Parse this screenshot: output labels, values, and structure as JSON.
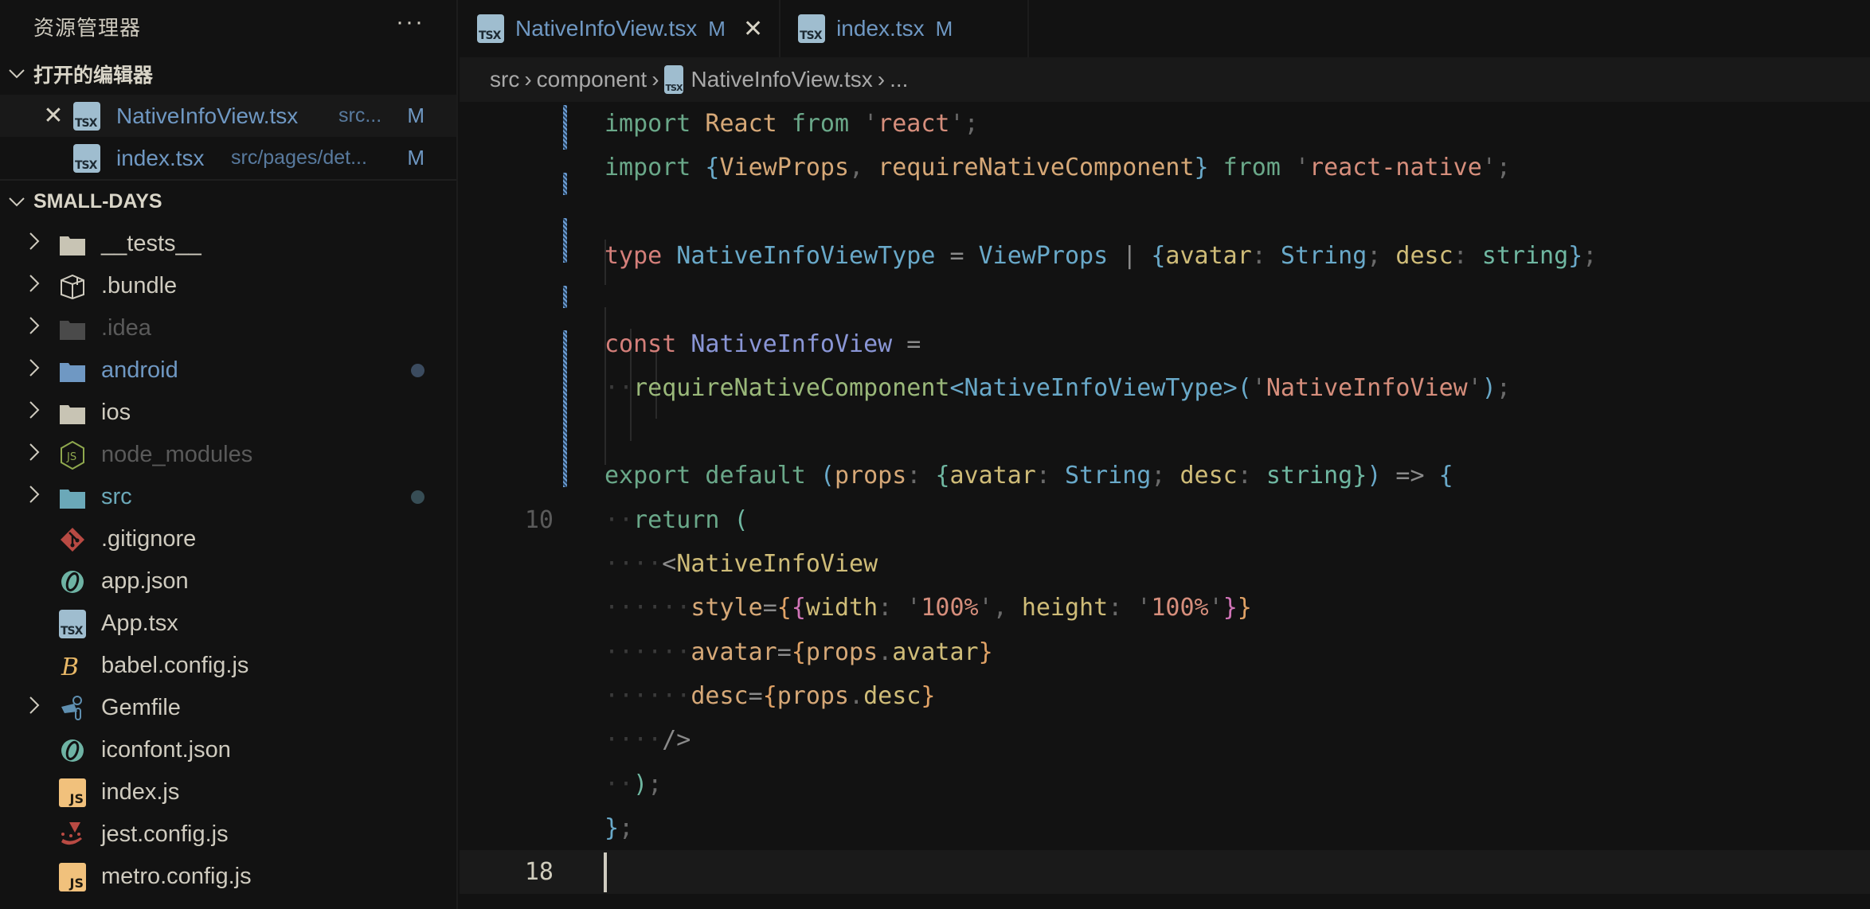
{
  "sidebar": {
    "title": "资源管理器",
    "more_label": "···",
    "open_editors": {
      "label": "打开的编辑器",
      "items": [
        {
          "name": "NativeInfoView.tsx",
          "path": "src...",
          "status": "M",
          "icon": "tsx-file-icon",
          "active": true
        },
        {
          "name": "index.tsx",
          "path": "src/pages/det...",
          "status": "M",
          "icon": "tsx-file-icon",
          "active": false
        }
      ]
    },
    "project": {
      "label": "SMALL-DAYS",
      "items": [
        {
          "name": "__tests__",
          "type": "folder",
          "icon": "folder-icon",
          "collapsed": true
        },
        {
          "name": ".bundle",
          "type": "folder",
          "icon": "package-box-icon",
          "collapsed": true
        },
        {
          "name": ".idea",
          "type": "folder",
          "icon": "folder-icon",
          "collapsed": true,
          "dimmed": true
        },
        {
          "name": "android",
          "type": "folder",
          "icon": "folder-icon",
          "collapsed": true,
          "modified": true
        },
        {
          "name": "ios",
          "type": "folder",
          "icon": "folder-icon",
          "collapsed": true
        },
        {
          "name": "node_modules",
          "type": "folder",
          "icon": "nodejs-icon",
          "collapsed": true,
          "dimmed": true
        },
        {
          "name": "src",
          "type": "folder",
          "icon": "folder-icon",
          "collapsed": true,
          "modified": true
        },
        {
          "name": ".gitignore",
          "type": "file",
          "icon": "git-icon"
        },
        {
          "name": "app.json",
          "type": "file",
          "icon": "json-swirl-icon"
        },
        {
          "name": "App.tsx",
          "type": "file",
          "icon": "tsx-file-icon"
        },
        {
          "name": "babel.config.js",
          "type": "file",
          "icon": "babel-icon"
        },
        {
          "name": "Gemfile",
          "type": "folder",
          "icon": "gemfile-icon",
          "collapsed": true
        },
        {
          "name": "iconfont.json",
          "type": "file",
          "icon": "json-swirl-icon"
        },
        {
          "name": "index.js",
          "type": "file",
          "icon": "js-file-icon"
        },
        {
          "name": "jest.config.js",
          "type": "file",
          "icon": "jest-icon"
        },
        {
          "name": "metro.config.js",
          "type": "file",
          "icon": "js-file-icon"
        }
      ]
    }
  },
  "editor": {
    "tabs": [
      {
        "name": "NativeInfoView.tsx",
        "status": "M",
        "active": true
      },
      {
        "name": "index.tsx",
        "status": "M",
        "active": false
      }
    ],
    "breadcrumb": [
      "src",
      "component",
      "NativeInfoView.tsx",
      "..."
    ],
    "visible_line_numbers": {
      "line_10": "10",
      "line_18": "18"
    },
    "code_lines": [
      "import React from 'react';",
      "import {ViewProps, requireNativeComponent} from 'react-native';",
      "",
      "type NativeInfoViewType = ViewProps | {avatar: String; desc: string};",
      "",
      "const NativeInfoView =",
      "  requireNativeComponent<NativeInfoViewType>('NativeInfoView');",
      "",
      "export default (props: {avatar: String; desc: string}) => {",
      "  return (",
      "    <NativeInfoView",
      "      style={{width: '100%', height: '100%'}}",
      "      avatar={props.avatar}",
      "      desc={props.desc}",
      "    />",
      "  );",
      "};",
      ""
    ],
    "tokens": {
      "l1": [
        "import",
        " React ",
        "from",
        " '",
        "react",
        "'",
        ";"
      ],
      "l2": [
        "import",
        " {",
        "ViewProps",
        ", ",
        "requireNativeComponent",
        "}",
        " from",
        " '",
        "react-native",
        "'",
        ";"
      ],
      "l4": [
        "type",
        " NativeInfoViewType",
        " = ",
        "ViewProps",
        " | ",
        "{",
        "avatar",
        ": ",
        "String",
        "; ",
        "desc",
        ": ",
        "string",
        "}",
        ";"
      ],
      "l6": [
        "const",
        " NativeInfoView",
        " ="
      ],
      "l7": [
        "··",
        "requireNativeComponent",
        "<",
        "NativeInfoViewType",
        ">",
        "(",
        "'",
        "NativeInfoView",
        "'",
        ")",
        ";"
      ],
      "l9": [
        "export",
        " default",
        " (",
        "props",
        ": ",
        "{",
        "avatar",
        ": ",
        "String",
        "; ",
        "desc",
        ": ",
        "string",
        "}",
        ")",
        " => ",
        "{"
      ],
      "l10": [
        "··",
        "return",
        " ("
      ],
      "l11": [
        "····",
        "<",
        "NativeInfoView"
      ],
      "l12": [
        "······",
        "style",
        "=",
        "{",
        "{",
        "width",
        ": ",
        "'",
        "100%",
        "'",
        ", ",
        "height",
        ": ",
        "'",
        "100%",
        "'",
        "}",
        "}"
      ],
      "l13": [
        "······",
        "avatar",
        "=",
        "{",
        "props",
        ".",
        "avatar",
        "}"
      ],
      "l14": [
        "······",
        "desc",
        "=",
        "{",
        "props",
        ".",
        "desc",
        "}"
      ],
      "l15": [
        "····",
        "/>"
      ],
      "l16": [
        "··",
        ")",
        ";"
      ],
      "l17": [
        "}",
        ";"
      ]
    }
  },
  "colors": {
    "background": "#121212",
    "breadcrumb_bg": "#191919",
    "modified_blue": "#6f98c3",
    "keyword_green": "#6aa889",
    "keyword_red": "#d47f7a",
    "string": "#d68e7c",
    "type_blue": "#69a9c9"
  }
}
